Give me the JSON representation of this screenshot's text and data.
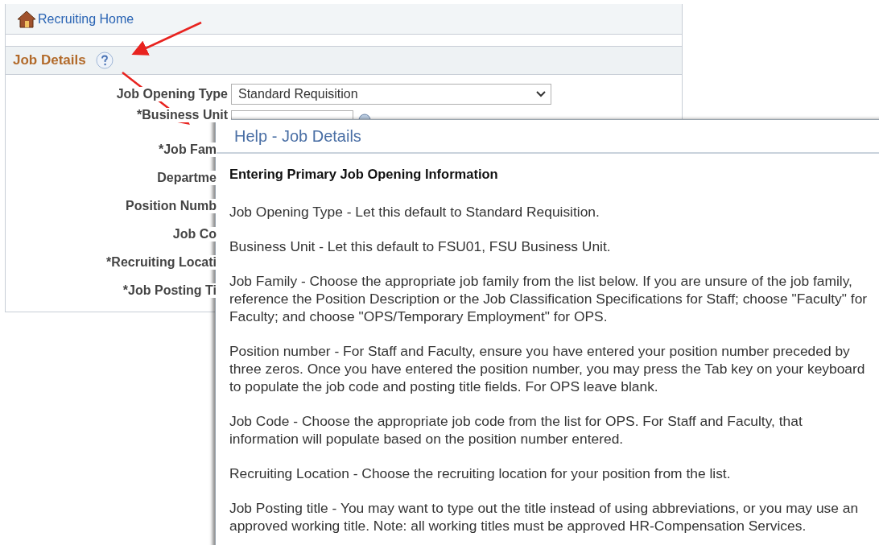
{
  "breadcrumb": {
    "label": "Recruiting Home"
  },
  "section": {
    "title": "Job Details"
  },
  "fields": [
    {
      "kind": "select",
      "label": "Job Opening Type",
      "value": "Standard Requisition"
    },
    {
      "kind": "lookup",
      "label": "*Business Unit"
    },
    {
      "kind": "label",
      "label": "*Job Fam"
    },
    {
      "kind": "label",
      "label": "Departme"
    },
    {
      "kind": "label",
      "label": "Position Numb"
    },
    {
      "kind": "label",
      "label": "Job Co"
    },
    {
      "kind": "label",
      "label": "*Recruiting Locati"
    },
    {
      "kind": "label",
      "label": "*Job Posting Ti"
    }
  ],
  "help_dialog": {
    "title": "Help - Job Details",
    "heading": "Entering Primary Job Opening Information",
    "paragraphs": [
      "Job Opening Type - Let this default to Standard Requisition.",
      "Business Unit - Let this default to FSU01, FSU Business Unit.",
      "Job Family - Choose the appropriate job family from the list below. If you are unsure of the job family, reference the Position Description or the Job Classification Specifications for Staff; choose \"Faculty\" for Faculty; and choose \"OPS/Temporary Employment\" for OPS.",
      "Position number - For Staff and Faculty, ensure you have entered your position number preceded by three zeros. Once you have entered the position number, you may press the Tab key on your keyboard to populate the job code and posting title fields. For OPS leave blank.",
      "Job Code - Choose the appropriate job code from the list for OPS. For Staff and Faculty, that information will populate based on the position number entered.",
      "Recruiting Location - Choose the recruiting location for your position from the list.",
      "Job Posting title - You may want to type out the title instead of using abbreviations, or you may use an approved working title. Note: all working titles must be approved HR-Compensation Services."
    ]
  }
}
